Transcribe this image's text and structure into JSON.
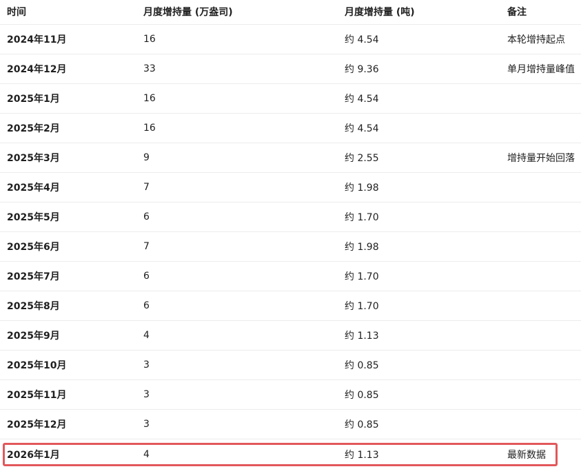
{
  "table": {
    "headers": [
      "时间",
      "月度增持量 (万盎司)",
      "月度增持量 (吨)",
      "备注"
    ],
    "rows": [
      [
        "2024年11月",
        "16",
        "约 4.54",
        "本轮增持起点"
      ],
      [
        "2024年12月",
        "33",
        "约 9.36",
        "单月增持量峰值"
      ],
      [
        "2025年1月",
        "16",
        "约 4.54",
        ""
      ],
      [
        "2025年2月",
        "16",
        "约 4.54",
        ""
      ],
      [
        "2025年3月",
        "9",
        "约 2.55",
        "增持量开始回落"
      ],
      [
        "2025年4月",
        "7",
        "约 1.98",
        ""
      ],
      [
        "2025年5月",
        "6",
        "约 1.70",
        ""
      ],
      [
        "2025年6月",
        "7",
        "约 1.98",
        ""
      ],
      [
        "2025年7月",
        "6",
        "约 1.70",
        ""
      ],
      [
        "2025年8月",
        "6",
        "约 1.70",
        ""
      ],
      [
        "2025年9月",
        "4",
        "约 1.13",
        ""
      ],
      [
        "2025年10月",
        "3",
        "约 0.85",
        ""
      ],
      [
        "2025年11月",
        "3",
        "约 0.85",
        ""
      ],
      [
        "2025年12月",
        "3",
        "约 0.85",
        ""
      ],
      [
        "2026年1月",
        "4",
        "约 1.13",
        "最新数据"
      ]
    ]
  },
  "highlight_color": "#e2575a"
}
